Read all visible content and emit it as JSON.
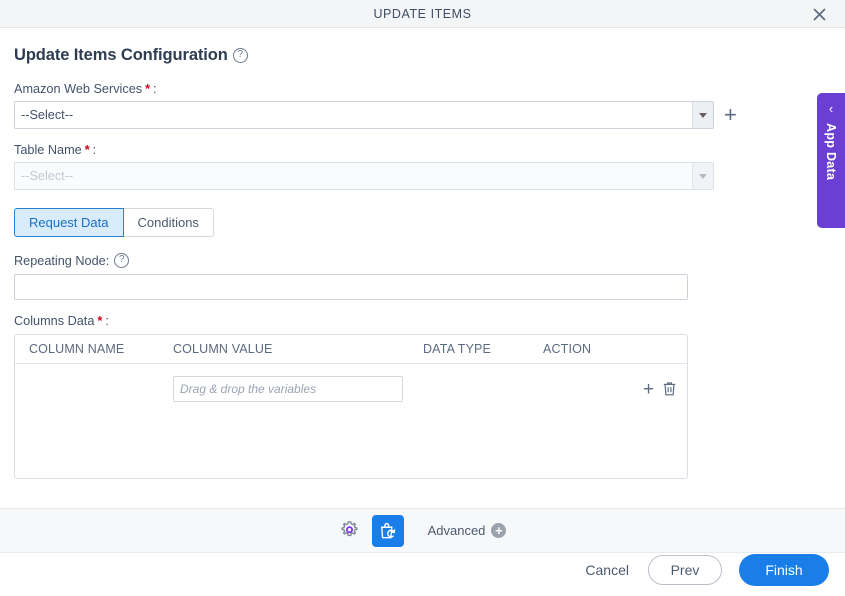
{
  "window": {
    "title": "UPDATE ITEMS",
    "close_icon": "close-icon"
  },
  "page": {
    "heading": "Update Items Configuration",
    "help_icon": "?"
  },
  "form": {
    "aws": {
      "label": "Amazon Web Services",
      "required_marker": "*",
      "colon": ":",
      "value": "--Select--",
      "add_icon": "+"
    },
    "table_name": {
      "label": "Table Name",
      "required_marker": "*",
      "colon": ":",
      "value": "--Select--"
    }
  },
  "tabs": [
    {
      "label": "Request Data",
      "active": true
    },
    {
      "label": "Conditions",
      "active": false
    }
  ],
  "repeating_node": {
    "label": "Repeating Node:",
    "help_icon": "?",
    "value": "",
    "placeholder": ""
  },
  "columns_data": {
    "label": "Columns Data",
    "required_marker": "*",
    "colon": ":",
    "headers": [
      "COLUMN NAME",
      "COLUMN VALUE",
      "DATA TYPE",
      "ACTION"
    ],
    "rows": [
      {
        "column_name": "",
        "column_value": "",
        "column_value_placeholder": "Drag & drop the variables",
        "data_type": "",
        "actions": [
          "add-row-icon",
          "delete-row-icon"
        ]
      }
    ]
  },
  "app_data_tab": {
    "label": "App Data",
    "chevron": "‹",
    "color": "#6b3fd4"
  },
  "toolbar": {
    "gear_icon": "gear-icon",
    "active_icon": "update-items-icon",
    "advanced_label": "Advanced",
    "advanced_plus": "+",
    "active_color": "#1a7ee8"
  },
  "actions": {
    "cancel_label": "Cancel",
    "prev_label": "Prev",
    "finish_label": "Finish",
    "finish_color": "#1a7ee8"
  }
}
